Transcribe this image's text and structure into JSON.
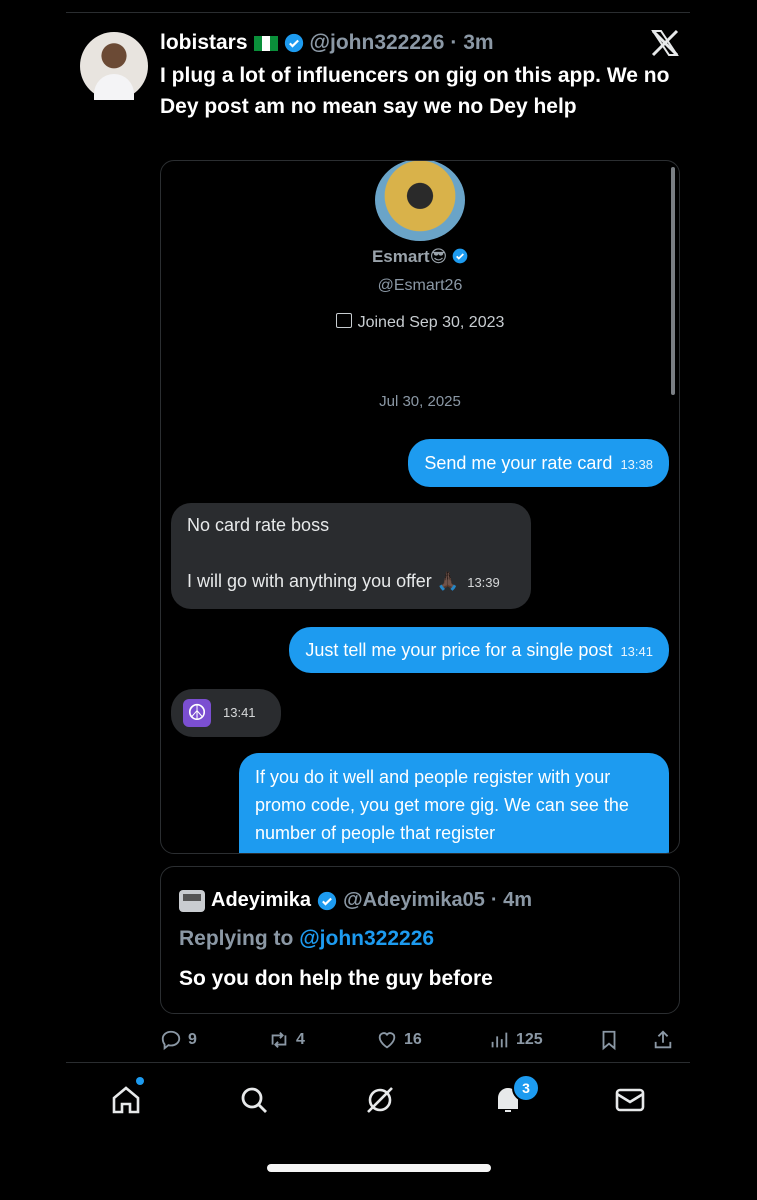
{
  "post": {
    "author_name": "lobistars",
    "handle": "@john322226",
    "time": "· 3m",
    "text": "I plug a lot of influencers on gig on this app. We no Dey post am no mean say we no Dey help"
  },
  "screenshot": {
    "profile_name": "Esmart😎",
    "profile_handle": "@Esmart26",
    "joined": "Joined Sep 30, 2023",
    "date": "Jul 30, 2025",
    "messages": [
      {
        "text": "Send me your rate card",
        "time": "13:38"
      },
      {
        "text_line1": "No card rate boss",
        "text_line2": "I will go with anything you offer 🙏🏿",
        "time": "13:39"
      },
      {
        "text": "Just tell me your price for a single post",
        "time": "13:41"
      },
      {
        "emoji": "☮",
        "time": "13:41"
      },
      {
        "text": "If you do it well and people register with your promo code, you get more gig. We can see the number of people that register"
      }
    ]
  },
  "reply": {
    "author_name": "Adeyimika",
    "handle": "@Adeyimika05",
    "time": "· 4m",
    "replying_label": "Replying to",
    "replying_handle": "@john322226",
    "text": "So you don help the guy before"
  },
  "actions": {
    "replies": "9",
    "reposts": "4",
    "likes": "16",
    "views": "125"
  },
  "nav": {
    "notifications_badge": "3"
  },
  "colors": {
    "accent": "#1d9bf0",
    "background": "#000000",
    "muted": "#8b98a5"
  }
}
